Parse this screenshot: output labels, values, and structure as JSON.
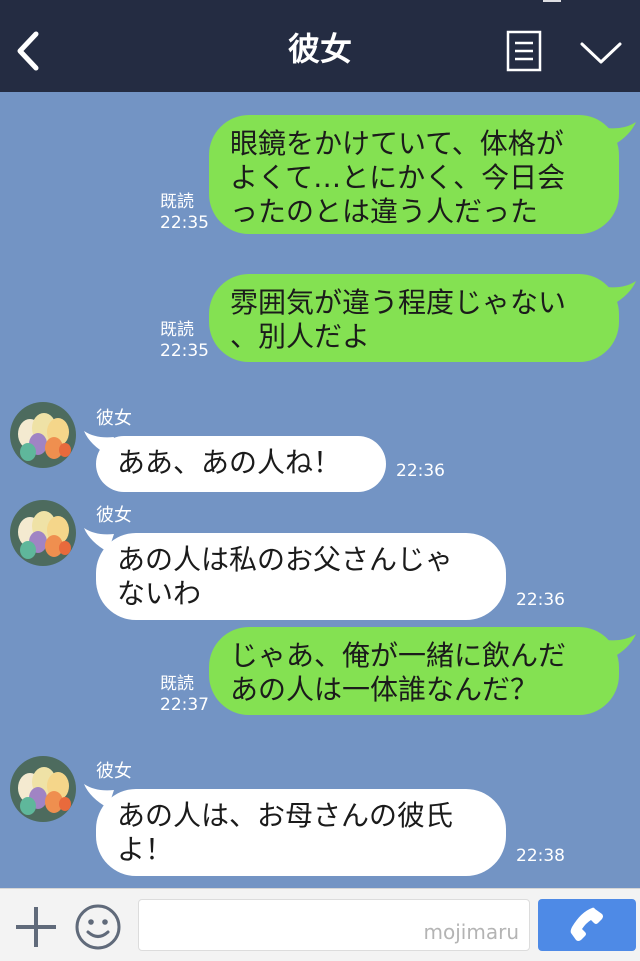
{
  "header": {
    "title": "彼女",
    "back_icon": "chevron-left-icon",
    "menu_icon": "list-icon",
    "collapse_icon": "chevron-down-icon"
  },
  "messages": [
    {
      "direction": "outgoing",
      "lines": [
        "眼鏡をかけていて、体格が",
        "よくて…とにかく、今日会",
        "ったのとは違う人だった"
      ],
      "read_label": "既読",
      "time": "22:35"
    },
    {
      "direction": "outgoing",
      "lines": [
        "雰囲気が違う程度じゃない",
        "、別人だよ"
      ],
      "read_label": "既読",
      "time": "22:35"
    },
    {
      "direction": "incoming",
      "sender": "彼女",
      "lines": [
        "ああ、あの人ね！"
      ],
      "time": "22:36"
    },
    {
      "direction": "incoming",
      "sender": "彼女",
      "lines": [
        "あの人は私のお父さんじゃ",
        "ないわ"
      ],
      "time": "22:36"
    },
    {
      "direction": "outgoing",
      "lines": [
        "じゃあ、俺が一緒に飲んだ",
        "あの人は一体誰なんだ？"
      ],
      "read_label": "既読",
      "time": "22:37"
    },
    {
      "direction": "incoming",
      "sender": "彼女",
      "lines": [
        "あの人は、お母さんの彼氏",
        "よ！"
      ],
      "time": "22:38"
    }
  ],
  "footer": {
    "input_value": "",
    "watermark": "mojimaru",
    "plus_icon": "plus-icon",
    "emoji_icon": "smiley-icon",
    "call_icon": "phone-icon"
  },
  "colors": {
    "background": "#7394c4",
    "header": "#242c42",
    "outgoing_bubble": "#84e152",
    "incoming_bubble": "#ffffff",
    "call_button": "#4e8ae6"
  }
}
